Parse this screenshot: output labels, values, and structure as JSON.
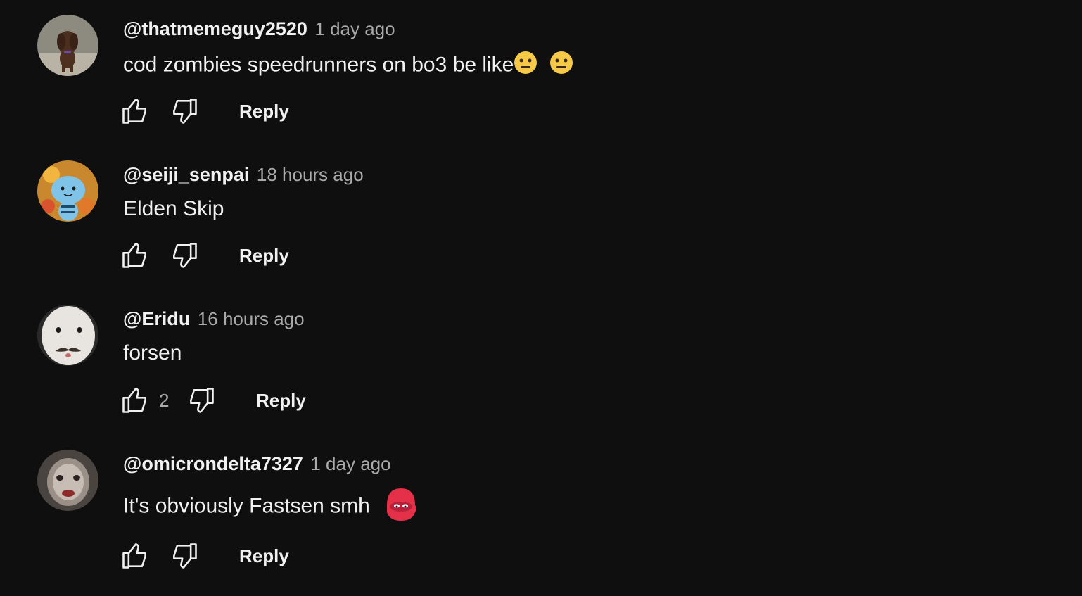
{
  "comments": [
    {
      "author": "@thatmemeguy2520",
      "time": "1 day ago",
      "text": "cod zombies speedrunners on bo3 be like",
      "emojis": [
        "neutral-face",
        "neutral-face"
      ],
      "likes": "",
      "reply_label": "Reply",
      "avatar": "dog-photo"
    },
    {
      "author": "@seiji_senpai",
      "time": "18 hours ago",
      "text": "Elden Skip",
      "likes": "",
      "reply_label": "Reply",
      "avatar": "blue-creature"
    },
    {
      "author": "@Eridu",
      "time": "16 hours ago",
      "text": "forsen",
      "likes": "2",
      "reply_label": "Reply",
      "avatar": "white-face-mustache"
    },
    {
      "author": "@omicrondelta7327",
      "time": "1 day ago",
      "text": "It's obviously Fastsen smh",
      "emojis": [
        "red-blob-emote"
      ],
      "likes": "",
      "reply_label": "Reply",
      "avatar": "blurry-face"
    }
  ],
  "colors": {
    "background": "#0f0f0f",
    "primary_text": "#f1f1f1",
    "secondary_text": "#aaaaaa"
  },
  "icons": {
    "like": "thumbs-up-icon",
    "dislike": "thumbs-down-icon"
  }
}
